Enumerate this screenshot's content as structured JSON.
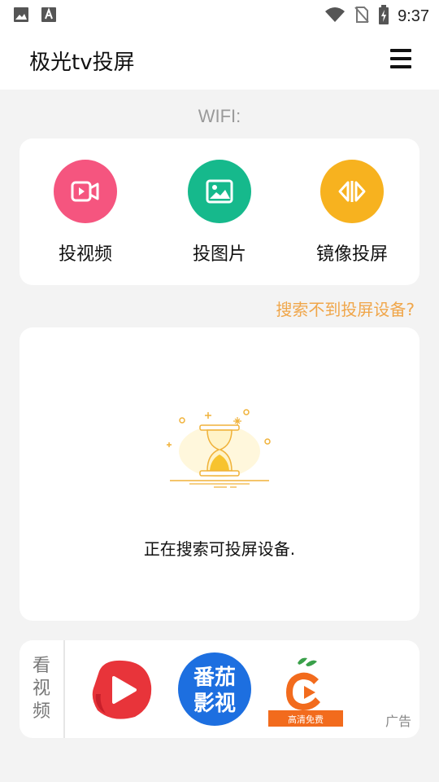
{
  "status_bar": {
    "time": "9:37",
    "left_icons": [
      "image-icon",
      "text-a-icon"
    ],
    "right_icons": [
      "wifi-icon",
      "no-sim-icon",
      "battery-charging-icon"
    ]
  },
  "app_bar": {
    "title": "极光tv投屏",
    "menu_icon": "hamburger-menu-icon"
  },
  "wifi_label": "WIFI:",
  "actions": [
    {
      "label": "投视频",
      "icon": "video-icon",
      "color": "#f5557f"
    },
    {
      "label": "投图片",
      "icon": "image-icon",
      "color": "#16b98c"
    },
    {
      "label": "镜像投屏",
      "icon": "mirror-icon",
      "color": "#f7b21f"
    }
  ],
  "help_link": "搜索不到投屏设备?",
  "search": {
    "status_text": "正在搜索可投屏设备.",
    "illustration": "hourglass-icon"
  },
  "ad": {
    "side_label": "看视频",
    "apps": [
      {
        "name": "play-app-icon",
        "color": "#e8343a"
      },
      {
        "name": "fanqie-app-icon",
        "text_line1": "番茄",
        "text_line2": "影视",
        "color": "#1d6fe0"
      },
      {
        "name": "orange-app-icon",
        "caption": "高清免费",
        "color": "#f26b1d"
      }
    ],
    "tag": "广告"
  }
}
